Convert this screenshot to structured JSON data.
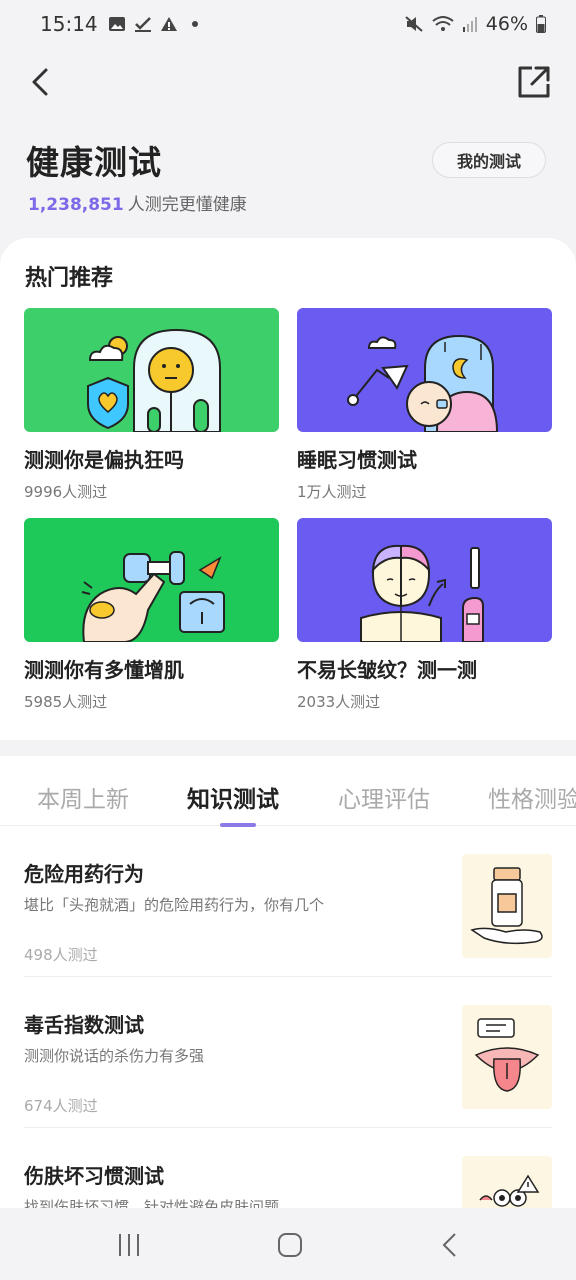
{
  "status_bar": {
    "time": "15:14",
    "battery": "46%",
    "icons": [
      "image-icon",
      "check-icon",
      "warning-icon",
      "dot-icon",
      "mute-icon",
      "wifi-icon",
      "signal-icon",
      "battery-icon"
    ]
  },
  "header": {
    "title": "健康测试",
    "my_tests_label": "我的测试",
    "participant_count": "1,238,851",
    "participant_suffix": "人测完更懂健康"
  },
  "hot": {
    "title": "热门推荐",
    "cards": [
      {
        "name": "测测你是偏执狂吗",
        "meta": "9996人测过",
        "bg": "#3dd06a"
      },
      {
        "name": "睡眠习惯测试",
        "meta": "1万人测过",
        "bg": "#6a5cf0"
      },
      {
        "name": "测测你有多懂增肌",
        "meta": "5985人测过",
        "bg": "#1ec95a"
      },
      {
        "name": "不易长皱纹？测一测",
        "meta": "2033人测过",
        "bg": "#6a5cf0"
      }
    ]
  },
  "tabs": [
    "本周上新",
    "知识测试",
    "心理评估",
    "性格测验"
  ],
  "active_tab": "知识测试",
  "items": [
    {
      "title": "危险用药行为",
      "desc": "堪比「头孢就酒」的危险用药行为，你有几个",
      "count": "498人测过"
    },
    {
      "title": "毒舌指数测试",
      "desc": "测测你说话的杀伤力有多强",
      "count": "674人测过"
    },
    {
      "title": "伤肤坏习惯测试",
      "desc": "找到伤肤坏习惯，针对性避免皮肤问题",
      "count": ""
    }
  ],
  "colors": {
    "accent": "#7d6ae8",
    "green": "#3dd06a",
    "purple": "#6a5cf0"
  }
}
